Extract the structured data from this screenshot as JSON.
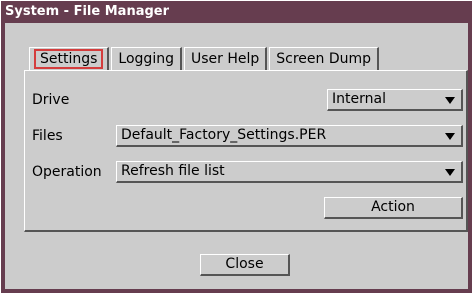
{
  "window": {
    "title": "System - File Manager"
  },
  "tabs": [
    {
      "label": "Settings",
      "active": true
    },
    {
      "label": "Logging",
      "active": false
    },
    {
      "label": "User Help",
      "active": false
    },
    {
      "label": "Screen Dump",
      "active": false
    }
  ],
  "settings": {
    "drive": {
      "label": "Drive",
      "value": "Internal"
    },
    "files": {
      "label": "Files",
      "value": "Default_Factory_Settings.PER"
    },
    "operation": {
      "label": "Operation",
      "value": "Refresh file list"
    },
    "action_label": "Action"
  },
  "close_label": "Close",
  "colors": {
    "titlebar": "#663d4f",
    "panel": "#cccccc",
    "active_tab_focus": "#d43c3c"
  }
}
